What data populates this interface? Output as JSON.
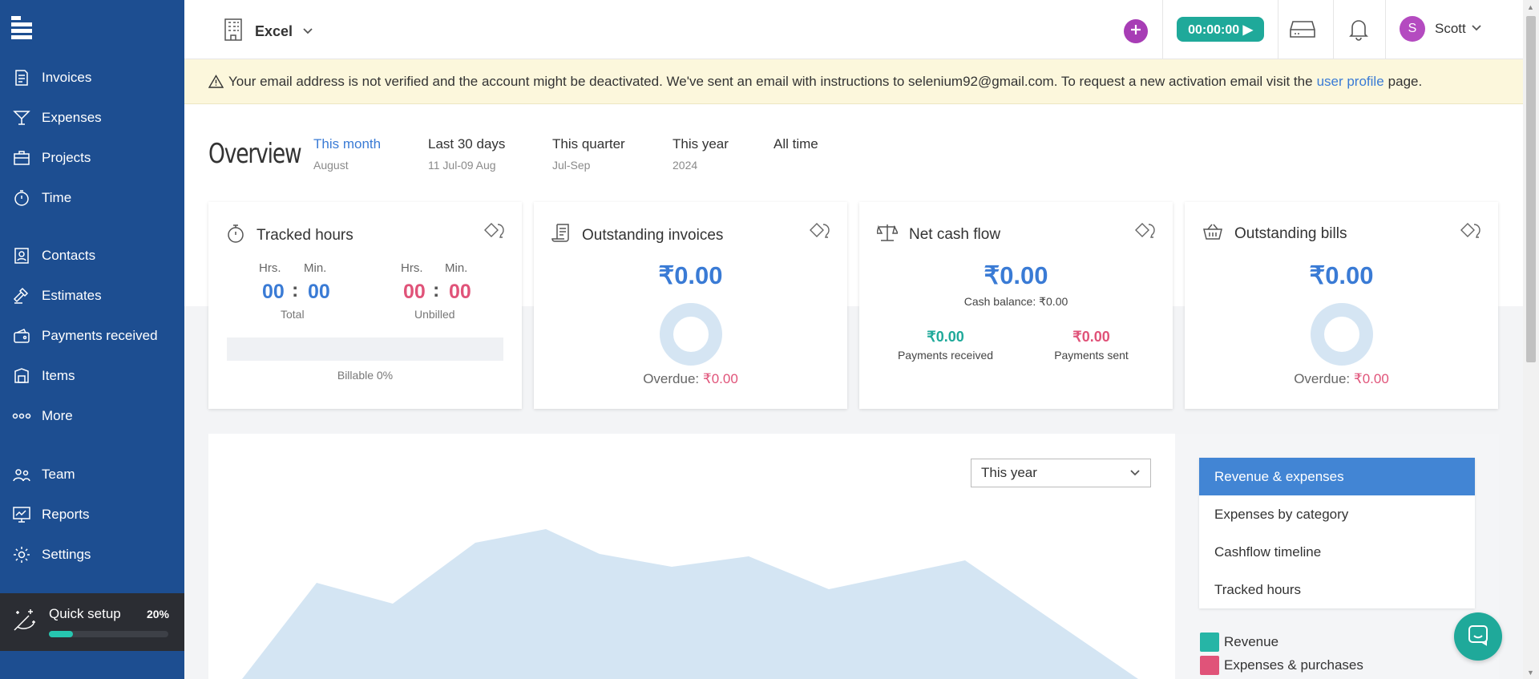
{
  "sidebar": {
    "items": [
      {
        "label": "Invoices",
        "icon": "invoice-icon"
      },
      {
        "label": "Expenses",
        "icon": "cocktail-icon"
      },
      {
        "label": "Projects",
        "icon": "briefcase-icon"
      },
      {
        "label": "Time",
        "icon": "stopwatch-icon"
      },
      {
        "label": "Contacts",
        "icon": "contacts-icon"
      },
      {
        "label": "Estimates",
        "icon": "gavel-icon"
      },
      {
        "label": "Payments received",
        "icon": "wallet-icon"
      },
      {
        "label": "Items",
        "icon": "items-icon"
      },
      {
        "label": "More",
        "icon": "more-dots-icon"
      },
      {
        "label": "Team",
        "icon": "team-icon"
      },
      {
        "label": "Reports",
        "icon": "reports-icon"
      },
      {
        "label": "Settings",
        "icon": "gear-icon"
      }
    ],
    "quick_setup": {
      "label": "Quick setup",
      "percent": "20%",
      "progress": 0.2
    }
  },
  "topbar": {
    "company": "Excel",
    "timer": "00:00:00 ▶",
    "user_initial": "S",
    "user_name": "Scott"
  },
  "warning": {
    "text_before": "Your email address is not verified and the account might be deactivated. We've sent an email with instructions to selenium92@gmail.com. To request a new activation email visit the",
    "link": "user profile",
    "text_after": "page."
  },
  "overview": {
    "title": "Overview",
    "periods": [
      {
        "label": "This month",
        "sub": "August"
      },
      {
        "label": "Last 30 days",
        "sub": "11 Jul-09 Aug"
      },
      {
        "label": "This quarter",
        "sub": "Jul-Sep"
      },
      {
        "label": "This year",
        "sub": "2024"
      },
      {
        "label": "All time",
        "sub": ""
      }
    ]
  },
  "cards": {
    "tracked": {
      "title": "Tracked hours",
      "hrs_label": "Hrs.",
      "min_label": "Min.",
      "total_hrs": "00",
      "total_min": "00",
      "total_label": "Total",
      "unbilled_hrs": "00",
      "unbilled_min": "00",
      "unbilled_label": "Unbilled",
      "colon": ":",
      "billable": "Billable 0%"
    },
    "invoices": {
      "title": "Outstanding invoices",
      "amount": "₹0.00",
      "overdue_label": "Overdue:",
      "overdue_value": "₹0.00"
    },
    "cashflow": {
      "title": "Net cash flow",
      "amount": "₹0.00",
      "balance": "Cash balance: ₹0.00",
      "received_value": "₹0.00",
      "received_label": "Payments received",
      "sent_value": "₹0.00",
      "sent_label": "Payments sent"
    },
    "bills": {
      "title": "Outstanding bills",
      "amount": "₹0.00",
      "overdue_label": "Overdue:",
      "overdue_value": "₹0.00"
    }
  },
  "chart": {
    "range_select": "This year",
    "tabs": [
      "Revenue & expenses",
      "Expenses by category",
      "Cashflow timeline",
      "Tracked hours"
    ],
    "legend": [
      {
        "label": "Revenue",
        "color": "#26b5a6"
      },
      {
        "label": "Expenses & purchases",
        "color": "#e05379"
      }
    ]
  },
  "colors": {
    "sidebar": "#1d4e91",
    "accent": "#3a7bd5",
    "teal": "#1fa99a",
    "pink": "#e05379",
    "purple": "#a73db5"
  }
}
